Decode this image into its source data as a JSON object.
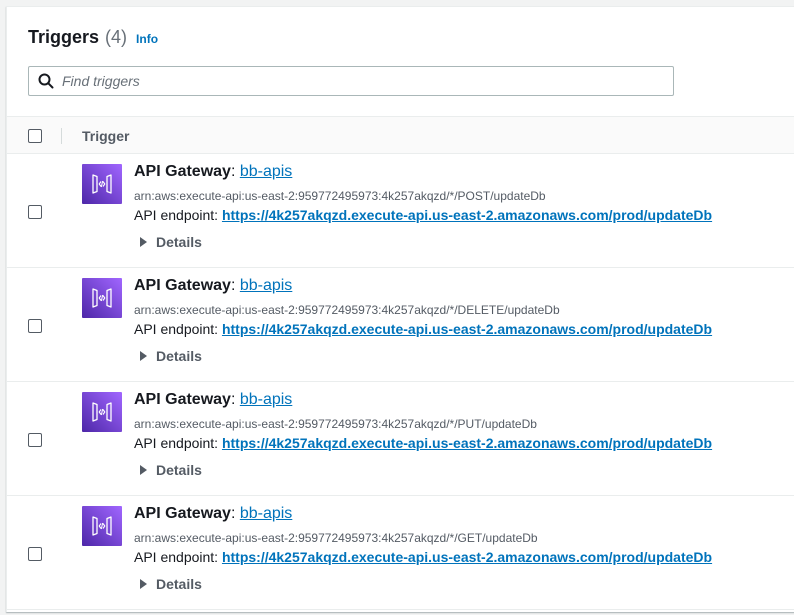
{
  "header": {
    "title": "Triggers",
    "count": "(4)",
    "info": "Info"
  },
  "search": {
    "placeholder": "Find triggers",
    "value": ""
  },
  "table": {
    "column_header": "Trigger",
    "rows": [
      {
        "service": "API Gateway",
        "api_name": "bb-apis",
        "arn": "arn:aws:execute-api:us-east-2:959772495973:4k257akqzd/*/POST/updateDb",
        "endpoint_label": "API endpoint:",
        "endpoint_url": "https://4k257akqzd.execute-api.us-east-2.amazonaws.com/prod/updateDb",
        "details_label": "Details"
      },
      {
        "service": "API Gateway",
        "api_name": "bb-apis",
        "arn": "arn:aws:execute-api:us-east-2:959772495973:4k257akqzd/*/DELETE/updateDb",
        "endpoint_label": "API endpoint:",
        "endpoint_url": "https://4k257akqzd.execute-api.us-east-2.amazonaws.com/prod/updateDb",
        "details_label": "Details"
      },
      {
        "service": "API Gateway",
        "api_name": "bb-apis",
        "arn": "arn:aws:execute-api:us-east-2:959772495973:4k257akqzd/*/PUT/updateDb",
        "endpoint_label": "API endpoint:",
        "endpoint_url": "https://4k257akqzd.execute-api.us-east-2.amazonaws.com/prod/updateDb",
        "details_label": "Details"
      },
      {
        "service": "API Gateway",
        "api_name": "bb-apis",
        "arn": "arn:aws:execute-api:us-east-2:959772495973:4k257akqzd/*/GET/updateDb",
        "endpoint_label": "API endpoint:",
        "endpoint_url": "https://4k257akqzd.execute-api.us-east-2.amazonaws.com/prod/updateDb",
        "details_label": "Details"
      }
    ]
  },
  "icons": {
    "search": "search-icon",
    "service": "api-gateway-icon",
    "expand": "caret-right-icon"
  },
  "colors": {
    "link": "#0073bb",
    "service_icon_gradient": [
      "#4d27a8",
      "#a166ff"
    ]
  }
}
